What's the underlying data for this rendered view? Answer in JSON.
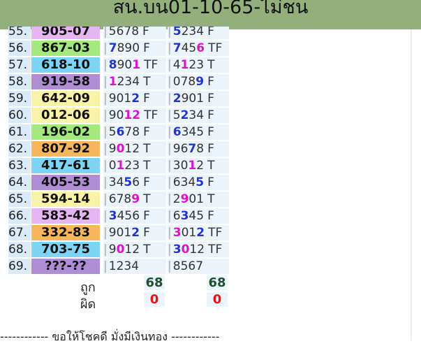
{
  "header": {
    "title": "สน.บน01-10-65-ไม่ชน"
  },
  "rows": [
    {
      "num": "55.",
      "result": "905-07",
      "bg": "#e6b6f2",
      "a": [
        [
          "5",
          ""
        ],
        [
          "6",
          ""
        ],
        [
          "7",
          ""
        ],
        [
          "8",
          ""
        ]
      ],
      "a_flag": "F",
      "b": [
        [
          "5",
          "b"
        ],
        [
          "2",
          ""
        ],
        [
          "3",
          ""
        ],
        [
          "4",
          ""
        ]
      ],
      "b_flag": "F"
    },
    {
      "num": "56.",
      "result": "867-03",
      "bg": "#a4e97e",
      "a": [
        [
          "7",
          "b"
        ],
        [
          "8",
          ""
        ],
        [
          "9",
          ""
        ],
        [
          "0",
          ""
        ]
      ],
      "a_flag": "F",
      "b": [
        [
          "7",
          "b"
        ],
        [
          "4",
          ""
        ],
        [
          "5",
          ""
        ],
        [
          "6",
          "m"
        ]
      ],
      "b_flag": "TF"
    },
    {
      "num": "57.",
      "result": "618-10",
      "bg": "#7ed4f5",
      "a": [
        [
          "8",
          "b"
        ],
        [
          "9",
          ""
        ],
        [
          "0",
          ""
        ],
        [
          "1",
          "m"
        ]
      ],
      "a_flag": "TF",
      "b": [
        [
          "4",
          ""
        ],
        [
          "1",
          "m"
        ],
        [
          "2",
          ""
        ],
        [
          "3",
          ""
        ]
      ],
      "b_flag": "T"
    },
    {
      "num": "58.",
      "result": "919-58",
      "bg": "#b08ed6",
      "a": [
        [
          "1",
          "m"
        ],
        [
          "2",
          ""
        ],
        [
          "3",
          ""
        ],
        [
          "4",
          ""
        ]
      ],
      "a_flag": "T",
      "b": [
        [
          "0",
          ""
        ],
        [
          "7",
          ""
        ],
        [
          "8",
          ""
        ],
        [
          "9",
          "b"
        ]
      ],
      "b_flag": "F"
    },
    {
      "num": "59.",
      "result": "642-09",
      "bg": "#f8f3a8",
      "a": [
        [
          "9",
          ""
        ],
        [
          "0",
          ""
        ],
        [
          "1",
          ""
        ],
        [
          "2",
          "b"
        ]
      ],
      "a_flag": "F",
      "b": [
        [
          "2",
          "b"
        ],
        [
          "9",
          ""
        ],
        [
          "0",
          ""
        ],
        [
          "1",
          ""
        ]
      ],
      "b_flag": "F"
    },
    {
      "num": "60.",
      "result": "012-06",
      "bg": "#f8f3a8",
      "a": [
        [
          "9",
          ""
        ],
        [
          "0",
          ""
        ],
        [
          "1",
          "m"
        ],
        [
          "2",
          "m"
        ]
      ],
      "a_flag": "TF",
      "b": [
        [
          "5",
          ""
        ],
        [
          "2",
          "b"
        ],
        [
          "3",
          ""
        ],
        [
          "4",
          ""
        ]
      ],
      "b_flag": "F"
    },
    {
      "num": "61.",
      "result": "196-02",
      "bg": "#a4e97e",
      "a": [
        [
          "5",
          ""
        ],
        [
          "6",
          "b"
        ],
        [
          "7",
          ""
        ],
        [
          "8",
          ""
        ]
      ],
      "a_flag": "F",
      "b": [
        [
          "6",
          "b"
        ],
        [
          "3",
          ""
        ],
        [
          "4",
          ""
        ],
        [
          "5",
          ""
        ]
      ],
      "b_flag": "F"
    },
    {
      "num": "62.",
      "result": "807-92",
      "bg": "#f6b65c",
      "a": [
        [
          "9",
          ""
        ],
        [
          "0",
          "m"
        ],
        [
          "1",
          ""
        ],
        [
          "2",
          ""
        ]
      ],
      "a_flag": "T",
      "b": [
        [
          "9",
          ""
        ],
        [
          "6",
          ""
        ],
        [
          "7",
          "b"
        ],
        [
          "8",
          ""
        ]
      ],
      "b_flag": "F"
    },
    {
      "num": "63.",
      "result": "417-61",
      "bg": "#7ed4f5",
      "a": [
        [
          "0",
          ""
        ],
        [
          "1",
          "m"
        ],
        [
          "2",
          ""
        ],
        [
          "3",
          ""
        ]
      ],
      "a_flag": "T",
      "b": [
        [
          "3",
          ""
        ],
        [
          "0",
          ""
        ],
        [
          "1",
          "m"
        ],
        [
          "2",
          ""
        ]
      ],
      "b_flag": "T"
    },
    {
      "num": "64.",
      "result": "405-53",
      "bg": "#b08ed6",
      "a": [
        [
          "3",
          ""
        ],
        [
          "4",
          ""
        ],
        [
          "5",
          "b"
        ],
        [
          "6",
          ""
        ]
      ],
      "a_flag": "F",
      "b": [
        [
          "6",
          ""
        ],
        [
          "3",
          ""
        ],
        [
          "4",
          ""
        ],
        [
          "5",
          "b"
        ]
      ],
      "b_flag": "F"
    },
    {
      "num": "65.",
      "result": "594-14",
      "bg": "#f8f3a8",
      "a": [
        [
          "6",
          ""
        ],
        [
          "7",
          ""
        ],
        [
          "8",
          ""
        ],
        [
          "9",
          "m"
        ]
      ],
      "a_flag": "T",
      "b": [
        [
          "2",
          ""
        ],
        [
          "9",
          "m"
        ],
        [
          "0",
          ""
        ],
        [
          "1",
          ""
        ]
      ],
      "b_flag": "T"
    },
    {
      "num": "66.",
      "result": "583-42",
      "bg": "#e6b6f2",
      "a": [
        [
          "3",
          "b"
        ],
        [
          "4",
          ""
        ],
        [
          "5",
          ""
        ],
        [
          "6",
          ""
        ]
      ],
      "a_flag": "F",
      "b": [
        [
          "6",
          ""
        ],
        [
          "3",
          "b"
        ],
        [
          "4",
          ""
        ],
        [
          "5",
          ""
        ]
      ],
      "b_flag": "F"
    },
    {
      "num": "67.",
      "result": "332-83",
      "bg": "#f6b65c",
      "a": [
        [
          "9",
          ""
        ],
        [
          "0",
          ""
        ],
        [
          "1",
          ""
        ],
        [
          "2",
          "b"
        ]
      ],
      "a_flag": "F",
      "b": [
        [
          "3",
          "m"
        ],
        [
          "0",
          ""
        ],
        [
          "1",
          ""
        ],
        [
          "2",
          "b"
        ]
      ],
      "b_flag": "TF"
    },
    {
      "num": "68.",
      "result": "703-75",
      "bg": "#7ed4f5",
      "a": [
        [
          "9",
          ""
        ],
        [
          "0",
          "m"
        ],
        [
          "1",
          ""
        ],
        [
          "2",
          ""
        ]
      ],
      "a_flag": "T",
      "b": [
        [
          "3",
          "b"
        ],
        [
          "0",
          "m"
        ],
        [
          "1",
          ""
        ],
        [
          "2",
          ""
        ]
      ],
      "b_flag": "TF"
    },
    {
      "num": "69.",
      "result": "???-??",
      "bg": "#b08ed6",
      "a": [
        [
          "1",
          ""
        ],
        [
          "2",
          ""
        ],
        [
          "3",
          ""
        ],
        [
          "4",
          ""
        ]
      ],
      "a_flag": "",
      "b": [
        [
          "8",
          ""
        ],
        [
          "5",
          ""
        ],
        [
          "6",
          ""
        ],
        [
          "7",
          ""
        ]
      ],
      "b_flag": ""
    }
  ],
  "summary": {
    "correct_label": "ถูก",
    "wrong_label": "ผิด",
    "a_correct": "68",
    "b_correct": "68",
    "a_wrong": "0",
    "b_wrong": "0"
  },
  "footer": {
    "text": "------------ ขอให้โชคดี มั่งมีเงินทอง ------------"
  }
}
